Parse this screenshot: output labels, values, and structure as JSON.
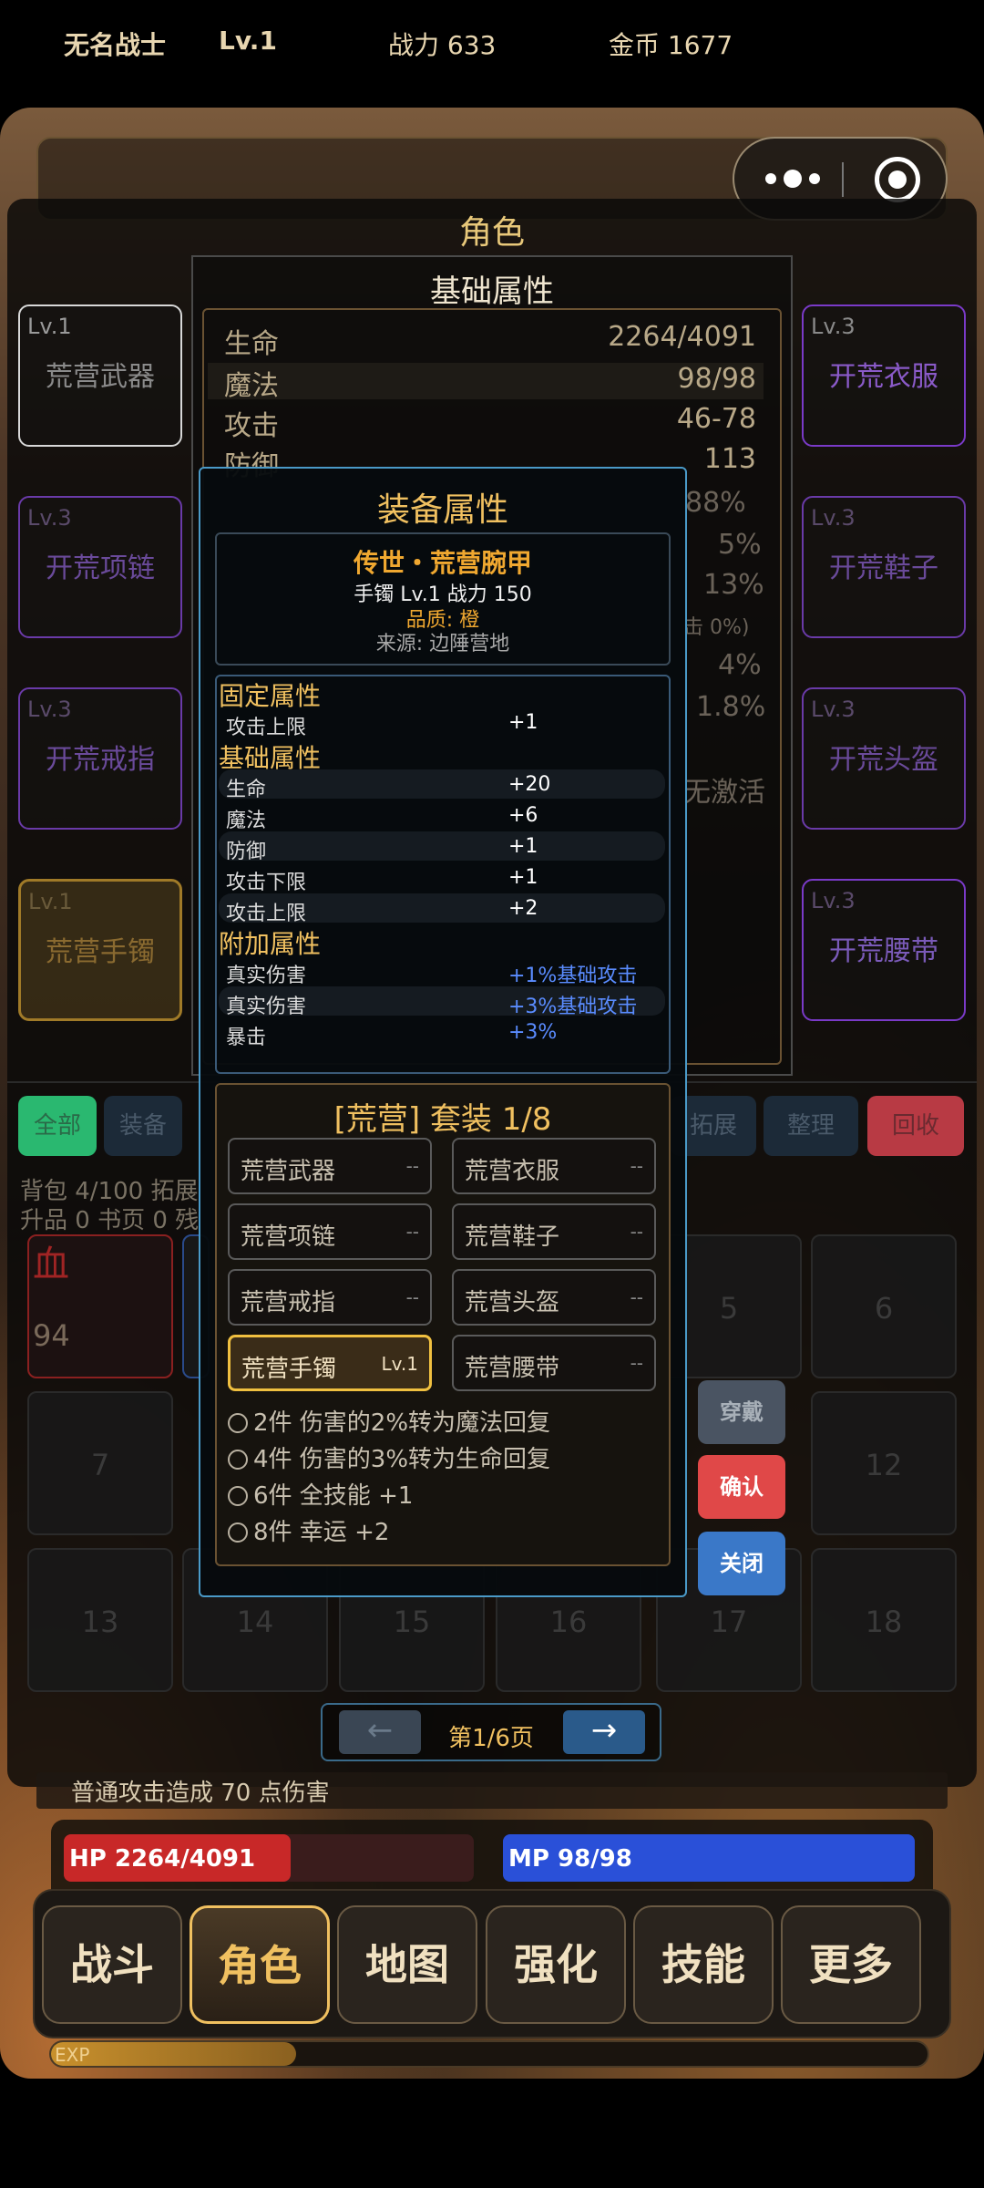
{
  "header": {
    "player_name": "无名战士",
    "level": "Lv.1",
    "power": "战力 633",
    "gold": "金币 1677"
  },
  "page_title": "角色",
  "equip_left": [
    {
      "lv": "Lv.1",
      "name": "荒营武器"
    },
    {
      "lv": "Lv.3",
      "name": "开荒项链"
    },
    {
      "lv": "Lv.3",
      "name": "开荒戒指"
    },
    {
      "lv": "Lv.1",
      "name": "荒营手镯"
    }
  ],
  "equip_right": [
    {
      "lv": "Lv.3",
      "name": "开荒衣服"
    },
    {
      "lv": "Lv.3",
      "name": "开荒鞋子"
    },
    {
      "lv": "Lv.3",
      "name": "开荒头盔"
    },
    {
      "lv": "Lv.3",
      "name": "开荒腰带"
    }
  ],
  "base_attrs": {
    "title": "基础属性",
    "rows": [
      {
        "k": "生命",
        "v": "2264/4091"
      },
      {
        "k": "魔法",
        "v": "98/98"
      },
      {
        "k": "攻击",
        "v": "46-78"
      },
      {
        "k": "防御",
        "v": "113"
      }
    ],
    "partial_values": [
      "88%",
      "5%",
      "13%",
      "击 0%)",
      "4%",
      "1.8%",
      "无激活"
    ]
  },
  "bag": {
    "tabs": [
      "全部",
      "装备",
      "拓展",
      "整理",
      "回收"
    ],
    "info_line1": "背包 4/100  拓展",
    "info_line2": "升品 0  书页 0  残",
    "slots": [
      "5",
      "6",
      "7",
      "12",
      "13",
      "14",
      "15",
      "16",
      "17",
      "18"
    ],
    "blood_item": {
      "name": "血",
      "count": "94"
    }
  },
  "modal": {
    "title": "装备属性",
    "item_name": "传世・荒营腕甲",
    "item_meta": "手镯 Lv.1  战力 150",
    "quality": "品质: 橙",
    "source": "来源: 边陲营地",
    "fixed_title": "固定属性",
    "fixed": [
      {
        "k": "攻击上限",
        "v": "+1"
      }
    ],
    "base_title": "基础属性",
    "base": [
      {
        "k": "生命",
        "v": "+20"
      },
      {
        "k": "魔法",
        "v": "+6"
      },
      {
        "k": "防御",
        "v": "+1"
      },
      {
        "k": "攻击下限",
        "v": "+1"
      },
      {
        "k": "攻击上限",
        "v": "+2"
      }
    ],
    "extra_title": "附加属性",
    "extra": [
      {
        "k": "真实伤害",
        "v": "+1%基础攻击"
      },
      {
        "k": "真实伤害",
        "v": "+3%基础攻击"
      },
      {
        "k": "暴击",
        "v": "+3%"
      }
    ],
    "set_title": "[荒营] 套装  1/8",
    "set_pieces": [
      {
        "name": "荒营武器",
        "state": "--"
      },
      {
        "name": "荒营衣服",
        "state": "--"
      },
      {
        "name": "荒营项链",
        "state": "--"
      },
      {
        "name": "荒营鞋子",
        "state": "--"
      },
      {
        "name": "荒营戒指",
        "state": "--"
      },
      {
        "name": "荒营头盔",
        "state": "--"
      },
      {
        "name": "荒营手镯",
        "state": "Lv.1"
      },
      {
        "name": "荒营腰带",
        "state": "--"
      }
    ],
    "set_bonuses": [
      "2件  伤害的2%转为魔法回复",
      "4件  伤害的3%转为生命回复",
      "6件  全技能 +1",
      "8件  幸运 +2"
    ],
    "btn_wear": "穿戴",
    "btn_confirm": "确认",
    "btn_close": "关闭"
  },
  "pager": {
    "prev": "←",
    "label": "第1/6页",
    "next": "→"
  },
  "combat_log": "普通攻击造成 70 点伤害",
  "hp": {
    "label": "HP 2264/4091",
    "fraction": 0.553
  },
  "mp": {
    "label": "MP 98/98",
    "fraction": 1.0
  },
  "nav": [
    "战斗",
    "角色",
    "地图",
    "强化",
    "技能",
    "更多"
  ],
  "nav_active": "角色",
  "exp": {
    "label": "EXP",
    "fraction": 0.28
  },
  "colors": {
    "gold": "#f0c060",
    "purple": "#9a5ad8",
    "hp_red": "#c82828",
    "mp_blue": "#2a50d8",
    "modal_border": "#4a9ac8",
    "confirm_red": "#e04848",
    "close_blue": "#3a78c8"
  }
}
